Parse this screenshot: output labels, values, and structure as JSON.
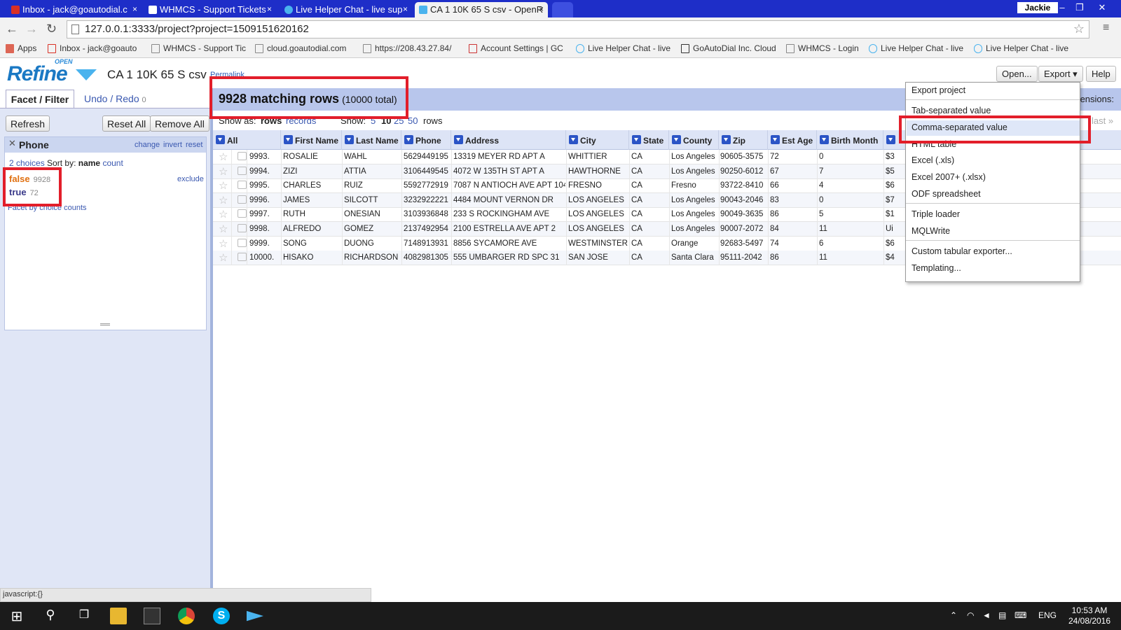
{
  "browser": {
    "tabs": [
      {
        "title": "Inbox - jack@goautodial.c",
        "icon_color": "#d93025",
        "icon": "gmail-icon"
      },
      {
        "title": "WHMCS - Support Tickets",
        "icon_color": "#ffffff",
        "icon": "document-icon"
      },
      {
        "title": "Live Helper Chat - live sup",
        "icon_color": "#4ab3ee",
        "icon": "chat-icon"
      },
      {
        "title": "CA 1 10K 65 S csv - OpenR",
        "icon_color": "#4ab3ee",
        "icon": "openrefine-icon"
      }
    ],
    "user": "Jackie",
    "url": "127.0.0.1:3333/project?project=1509151620162",
    "bookmarks": [
      "Apps",
      "Inbox - jack@goauto",
      "WHMCS - Support Tic",
      "cloud.goautodial.com",
      "https://208.43.27.84/",
      "Account Settings | GC",
      "Live Helper Chat - live",
      "GoAutoDial Inc. Cloud",
      "WHMCS - Login",
      "Live Helper Chat - live",
      "Live Helper Chat - live"
    ],
    "status_text": "javascript:{}"
  },
  "app": {
    "logo_open": "OPEN",
    "logo_refine": "Refine",
    "project_title": "CA 1 10K 65 S csv",
    "permalink": "Permalink",
    "header_buttons": {
      "open": "Open...",
      "export": "Export ▾",
      "help": "Help"
    }
  },
  "left": {
    "tab_facet": "Facet / Filter",
    "tab_undo": "Undo / Redo",
    "undo_count": "0",
    "refresh": "Refresh",
    "reset_all": "Reset All",
    "remove_all": "Remove All",
    "facet": {
      "title": "Phone",
      "links": {
        "change": "change",
        "invert": "invert",
        "reset": "reset"
      },
      "choices_label": "2 choices",
      "sort_by": "Sort by:",
      "sort_name": "name",
      "sort_count": "count",
      "exclude": "exclude",
      "items": [
        {
          "label": "false",
          "count": "9928",
          "selected": true
        },
        {
          "label": "true",
          "count": "72",
          "selected": false
        }
      ],
      "facet_by": "Facet by choice counts"
    }
  },
  "main": {
    "matching_rows": "9928 matching rows",
    "total": "(10000 total)",
    "extensions": "ensions:",
    "show_as": "Show as:",
    "rows_label": "rows",
    "records_label": "records",
    "show": "Show:",
    "page_sizes": [
      "5",
      "10",
      "25",
      "50"
    ],
    "rows_suffix": "rows",
    "last": "last »",
    "columns": [
      "All",
      "First Name",
      "Last Name",
      "Phone",
      "Address",
      "City",
      "State",
      "County",
      "Zip",
      "Est Age",
      "Birth Month",
      ""
    ],
    "rows": [
      {
        "n": "9993.",
        "first": "ROSALIE",
        "last": "WAHL",
        "phone": "5629449195",
        "address": "13319 MEYER RD APT A",
        "city": "WHITTIER",
        "state": "CA",
        "county": "Los Angeles",
        "zip": "90605-3575",
        "age": "72",
        "month": "0",
        "extra": "$3"
      },
      {
        "n": "9994.",
        "first": "ZIZI",
        "last": "ATTIA",
        "phone": "3106449545",
        "address": "4072 W 135TH ST APT A",
        "city": "HAWTHORNE",
        "state": "CA",
        "county": "Los Angeles",
        "zip": "90250-6012",
        "age": "67",
        "month": "7",
        "extra": "$5"
      },
      {
        "n": "9995.",
        "first": "CHARLES",
        "last": "RUIZ",
        "phone": "5592772919",
        "address": "7087 N ANTIOCH AVE APT 104",
        "city": "FRESNO",
        "state": "CA",
        "county": "Fresno",
        "zip": "93722-8410",
        "age": "66",
        "month": "4",
        "extra": "$6"
      },
      {
        "n": "9996.",
        "first": "JAMES",
        "last": "SILCOTT",
        "phone": "3232922221",
        "address": "4484 MOUNT VERNON DR",
        "city": "LOS ANGELES",
        "state": "CA",
        "county": "Los Angeles",
        "zip": "90043-2046",
        "age": "83",
        "month": "0",
        "extra": "$7"
      },
      {
        "n": "9997.",
        "first": "RUTH",
        "last": "ONESIAN",
        "phone": "3103936848",
        "address": "233 S ROCKINGHAM AVE",
        "city": "LOS ANGELES",
        "state": "CA",
        "county": "Los Angeles",
        "zip": "90049-3635",
        "age": "86",
        "month": "5",
        "extra": "$1"
      },
      {
        "n": "9998.",
        "first": "ALFREDO",
        "last": "GOMEZ",
        "phone": "2137492954",
        "address": "2100 ESTRELLA AVE APT 2",
        "city": "LOS ANGELES",
        "state": "CA",
        "county": "Los Angeles",
        "zip": "90007-2072",
        "age": "84",
        "month": "11",
        "extra": "Ui"
      },
      {
        "n": "9999.",
        "first": "SONG",
        "last": "DUONG",
        "phone": "7148913931",
        "address": "8856 SYCAMORE AVE",
        "city": "WESTMINSTER",
        "state": "CA",
        "county": "Orange",
        "zip": "92683-5497",
        "age": "74",
        "month": "6",
        "extra": "$6"
      },
      {
        "n": "10000.",
        "first": "HISAKO",
        "last": "RICHARDSON",
        "phone": "4082981305",
        "address": "555 UMBARGER RD SPC 31",
        "city": "SAN JOSE",
        "state": "CA",
        "county": "Santa Clara",
        "zip": "95111-2042",
        "age": "86",
        "month": "11",
        "extra": "$4"
      }
    ]
  },
  "export_menu": {
    "items": [
      "Export project",
      "Tab-separated value",
      "Comma-separated value",
      "HTML table",
      "Excel (.xls)",
      "Excel 2007+ (.xlsx)",
      "ODF spreadsheet",
      "Triple loader",
      "MQLWrite",
      "Custom tabular exporter...",
      "Templating..."
    ],
    "highlighted": "Comma-separated value"
  },
  "taskbar": {
    "language": "ENG",
    "time": "10:53 AM",
    "date": "24/08/2016"
  },
  "colors": {
    "tabbar": "#1e2ec8",
    "highlight_box": "#e21e2a",
    "summary_bar": "#b8c6ec",
    "accent_link": "#3a58b0"
  }
}
